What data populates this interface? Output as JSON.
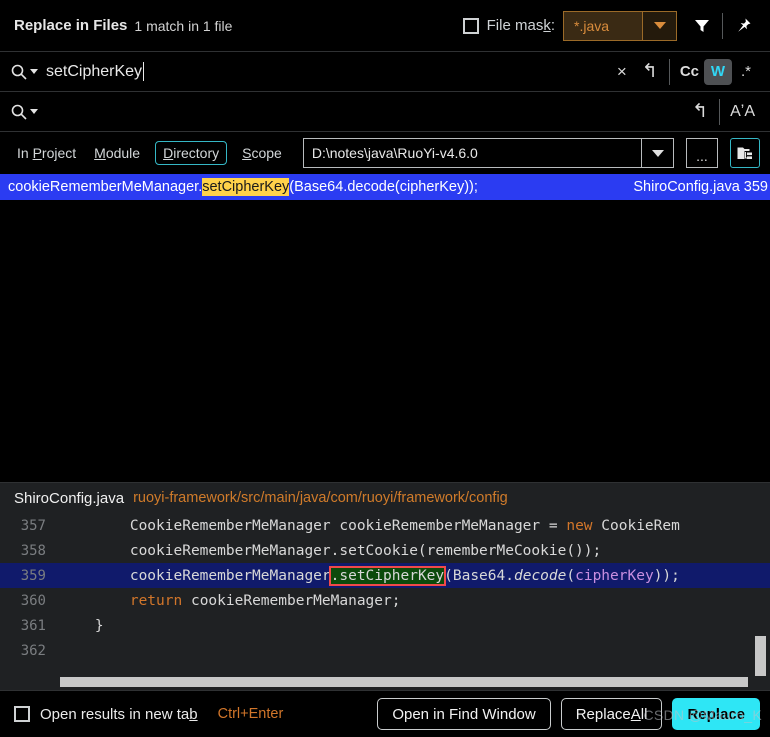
{
  "titlebar": {
    "title": "Replace in Files",
    "match_info": "1 match in 1 file",
    "file_mask_label_a": "File mas",
    "file_mask_label_mnemonic": "k",
    "file_mask_label_b": ":",
    "file_mask_value": "*.java",
    "filter_icon": "filter-icon",
    "pin_icon": "pin-icon"
  },
  "search": {
    "value": "setCipherKey",
    "clear_label": "×",
    "reset_label": "↰",
    "case_sensitive_label": "Cc",
    "words_label": "W",
    "regex_label": ".*"
  },
  "replace": {
    "value": "",
    "placeholder": "",
    "reset_label": "↰",
    "preserve_case_label": "AʼA"
  },
  "scope": {
    "in_project_pre": "In ",
    "in_project_mn": "P",
    "in_project_post": "roject",
    "module_mn": "M",
    "module_post": "odule",
    "directory_mn": "D",
    "directory_post": "irectory",
    "scope_mn": "S",
    "scope_post": "cope",
    "selected": "Directory",
    "path": "D:\\notes\\java\\RuoYi-v4.6.0",
    "browse_label": "...",
    "recursive_icon": "recursive-folder-icon"
  },
  "results": {
    "rows": [
      {
        "prefix": "cookieRememberMeManager.",
        "match": "setCipherKey",
        "suffix": "(Base64.decode(cipherKey));",
        "file": "ShiroConfig.java",
        "line": "359"
      }
    ]
  },
  "preview": {
    "file_name": "ShiroConfig.java",
    "file_path": "ruoyi-framework/src/main/java/com/ruoyi/framework/config",
    "lines": [
      {
        "num": "357",
        "indent": "        ",
        "pre": "CookieRememberMeManager cookieRememberMeManager = ",
        "kw": "new",
        "post": " CookieRem"
      },
      {
        "num": "358",
        "indent": "        ",
        "text": "cookieRememberMeManager.setCookie(rememberMeCookie());"
      },
      {
        "num": "359",
        "indent": "        ",
        "pre": "cookieRememberMeManager",
        "match": ".setCipherKey",
        "mid_a": "(Base64.",
        "italic": "decode",
        "mid_b": "(",
        "purple": "cipherKey",
        "post": "));"
      },
      {
        "num": "360",
        "indent": "        ",
        "kw": "return",
        "post": " cookieRememberMeManager;"
      },
      {
        "num": "361",
        "indent": "    ",
        "text": "}"
      },
      {
        "num": "362",
        "indent": "",
        "text": ""
      }
    ]
  },
  "bottom": {
    "open_new_tab_a": "Open results in new ta",
    "open_new_tab_mn": "b",
    "shortcut": "Ctrl+Enter",
    "open_find_window": "Open in Find Window",
    "replace_all_a": "Replace ",
    "replace_all_mn": "A",
    "replace_all_b": "ll",
    "replace": "Replace",
    "watermark": "CSDN @Mauro_K"
  },
  "colors": {
    "accent": "#2ee6f5",
    "selection_blue": "#2b3cf2",
    "match_yellow": "#ffd24a",
    "orange": "#d2762a",
    "match_green": "#0c4a0c",
    "match_border": "#f04a4a"
  }
}
